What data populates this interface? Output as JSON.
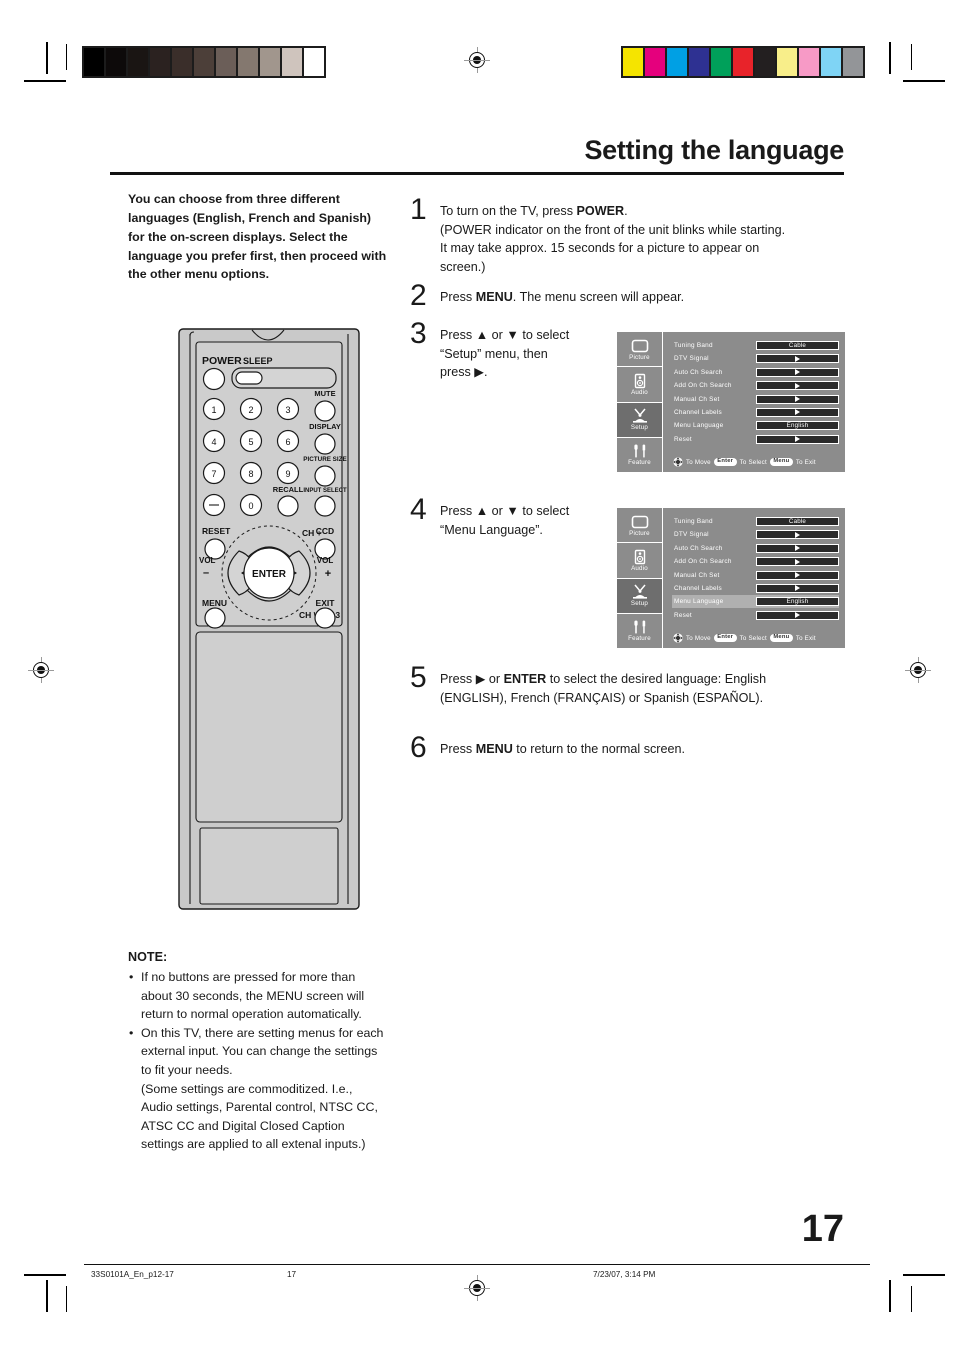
{
  "header": {
    "title": "Setting the language"
  },
  "intro": {
    "text": "You can choose from three different languages (English, French and Spanish) for the on-screen displays. Select the language you prefer first, then proceed with the other menu options."
  },
  "steps": [
    {
      "number": "1",
      "lines": [
        [
          {
            "t": "To turn on the TV, press "
          },
          {
            "t": "POWER",
            "b": true
          },
          {
            "t": "."
          }
        ],
        [
          {
            "t": "(POWER indicator on the front of the unit blinks while starting."
          }
        ],
        [
          {
            "t": "It may take approx. 15 seconds for a picture to appear on"
          }
        ],
        [
          {
            "t": "screen.)"
          }
        ]
      ]
    },
    {
      "number": "2",
      "lines": [
        [
          {
            "t": "Press "
          },
          {
            "t": "MENU",
            "b": true
          },
          {
            "t": ". The menu screen will appear."
          }
        ]
      ]
    },
    {
      "number": "3",
      "lines": [
        [
          {
            "t": "Press ▲ or ▼ to select"
          }
        ],
        [
          {
            "t": "“Setup” menu, then"
          }
        ],
        [
          {
            "t": "press ▶."
          }
        ]
      ]
    },
    {
      "number": "4",
      "lines": [
        [
          {
            "t": "Press ▲ or ▼ to select"
          }
        ],
        [
          {
            "t": "“Menu Language”."
          }
        ]
      ]
    },
    {
      "number": "5",
      "lines": [
        [
          {
            "t": "Press ▶ or "
          },
          {
            "t": "ENTER",
            "b": true
          },
          {
            "t": " to select the desired language: English"
          }
        ],
        [
          {
            "t": "(ENGLISH), French (FRANÇAIS) or Spanish (ESPAÑOL)."
          }
        ]
      ]
    },
    {
      "number": "6",
      "lines": [
        [
          {
            "t": "Press "
          },
          {
            "t": "MENU",
            "b": true
          },
          {
            "t": " to return to the normal screen."
          }
        ]
      ]
    }
  ],
  "remote": {
    "labels": {
      "power": "POWER",
      "sleep": "SLEEP",
      "mute": "MUTE",
      "display": "DISPLAY",
      "picture_size": "PICTURE SIZE",
      "recall": "RECALL",
      "input_select": "INPUT SELECT",
      "reset": "RESET",
      "ccd": "CCD",
      "ch_plus": "CH +",
      "ch_minus": "CH –",
      "vol_minus_top": "VOL",
      "vol_minus_sign": "–",
      "vol_plus_top": "VOL",
      "vol_plus_sign": "+",
      "enter": "ENTER",
      "menu": "MENU",
      "exit": "EXIT"
    },
    "numpad": [
      "1",
      "2",
      "3",
      "4",
      "5",
      "6",
      "7",
      "8",
      "9",
      "–",
      "0"
    ]
  },
  "osd": {
    "sidebar": [
      {
        "label": "Picture",
        "icon": "tv-screen-icon"
      },
      {
        "label": "Audio",
        "icon": "speaker-icon"
      },
      {
        "label": "Setup",
        "icon": "antenna-tv-icon"
      },
      {
        "label": "Feature",
        "icon": "tools-icon"
      }
    ],
    "active_sidebar_index": 2,
    "rows": [
      {
        "label": "Tuning Band",
        "value": "Cable",
        "kind": "text"
      },
      {
        "label": "DTV Signal",
        "value": "",
        "kind": "arrow"
      },
      {
        "label": "Auto Ch Search",
        "value": "",
        "kind": "arrow"
      },
      {
        "label": "Add On Ch Search",
        "value": "",
        "kind": "arrow"
      },
      {
        "label": "Manual Ch Set",
        "value": "",
        "kind": "arrow"
      },
      {
        "label": "Channel Labels",
        "value": "",
        "kind": "arrow"
      },
      {
        "label": "Menu Language",
        "value": "English",
        "kind": "text"
      },
      {
        "label": "Reset",
        "value": "",
        "kind": "arrow"
      }
    ],
    "hint": {
      "to_move": "To Move",
      "enter_key": "Enter",
      "to_select": "To Select",
      "menu_key": "Menu",
      "to_exit": "To Exit"
    },
    "screen1_highlight_row": -1,
    "screen2_highlight_row": 6
  },
  "note": {
    "title": "NOTE:",
    "items": [
      "If no buttons are pressed for more than about 30 seconds, the MENU screen will return to normal operation automatically.",
      "On this TV, there are setting menus for each external input. You can change the settings to fit your needs.\n(Some settings are commoditized. I.e., Audio settings, Parental control, NTSC CC, ATSC CC and Digital Closed Caption settings are applied to all extenal inputs.)"
    ]
  },
  "page_number": "17",
  "footer": {
    "doc_id": "33S0101A_En_p12-17",
    "page": "17",
    "timestamp": "7/23/07, 3:14 PM"
  },
  "colorbars": {
    "gray": [
      "#000000",
      "#0d0a0a",
      "#1a1513",
      "#2b2220",
      "#3a2e2a",
      "#4c3f39",
      "#6b5e58",
      "#84786f",
      "#a1968d",
      "#cfc4bd",
      "#ffffff"
    ],
    "color": [
      "#f5e400",
      "#e5007d",
      "#00a0e4",
      "#2e3192",
      "#00a05a",
      "#e8232a",
      "#231f20",
      "#f8ee8a",
      "#f79ac6",
      "#7fd4f5",
      "#939598"
    ]
  }
}
